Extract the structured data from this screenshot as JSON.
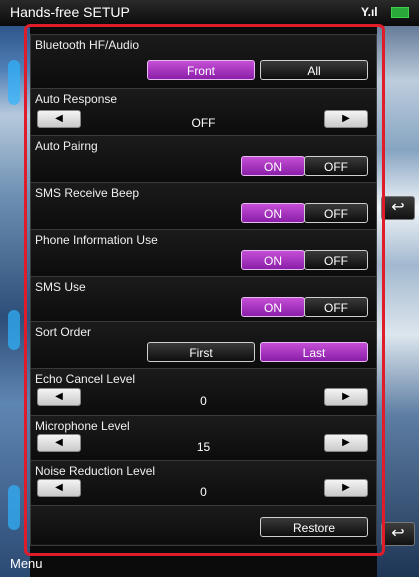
{
  "header": {
    "title": "Hands-free SETUP",
    "signal": "Y.ıl"
  },
  "menu_label": "Menu",
  "rows": {
    "bt": {
      "label": "Bluetooth HF/Audio",
      "options": [
        "Front",
        "All"
      ],
      "selected": "Front"
    },
    "auto_response": {
      "label": "Auto Response",
      "value": "OFF"
    },
    "auto_pairing": {
      "label": "Auto Pairng",
      "on": "ON",
      "off": "OFF",
      "selected": "ON"
    },
    "sms_beep": {
      "label": "SMS Receive Beep",
      "on": "ON",
      "off": "OFF",
      "selected": "ON"
    },
    "phone_info": {
      "label": "Phone Information Use",
      "on": "ON",
      "off": "OFF",
      "selected": "ON"
    },
    "sms_use": {
      "label": "SMS Use",
      "on": "ON",
      "off": "OFF",
      "selected": "ON"
    },
    "sort_order": {
      "label": "Sort Order",
      "options": [
        "First",
        "Last"
      ],
      "selected": "Last"
    },
    "echo": {
      "label": "Echo Cancel Level",
      "value": "0"
    },
    "mic": {
      "label": "Microphone Level",
      "value": "15"
    },
    "noise": {
      "label": "Noise Reduction Level",
      "value": "0"
    }
  },
  "restore_label": "Restore",
  "icons": {
    "left_arrow": "◀",
    "right_arrow": "▶",
    "back": "↩"
  },
  "colors": {
    "active": "#a532c0",
    "frame": "#e01c2a"
  }
}
